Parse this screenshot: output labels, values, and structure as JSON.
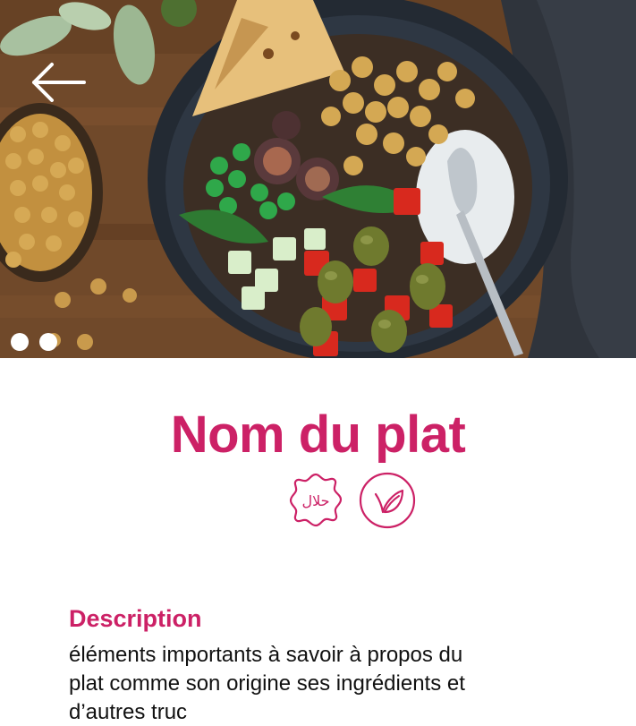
{
  "hero": {
    "image_alt": "Bol de salade avec pois chiches, olives, poivrons, concombre, figues et pain",
    "carousel": {
      "dot_count": 2,
      "active_index": 0
    },
    "back_icon": "arrow-left-icon"
  },
  "dish": {
    "name": "Nom du plat",
    "badges": [
      {
        "icon": "halal-badge-icon",
        "text": "حلال"
      },
      {
        "icon": "vegetarian-leaf-icon"
      }
    ]
  },
  "description": {
    "label": "Description",
    "text": "éléments importants à savoir à propos du plat comme son origine ses ingrédients et d’autres truc"
  },
  "colors": {
    "accent": "#cc2166",
    "text": "#111111",
    "background": "#ffffff"
  }
}
